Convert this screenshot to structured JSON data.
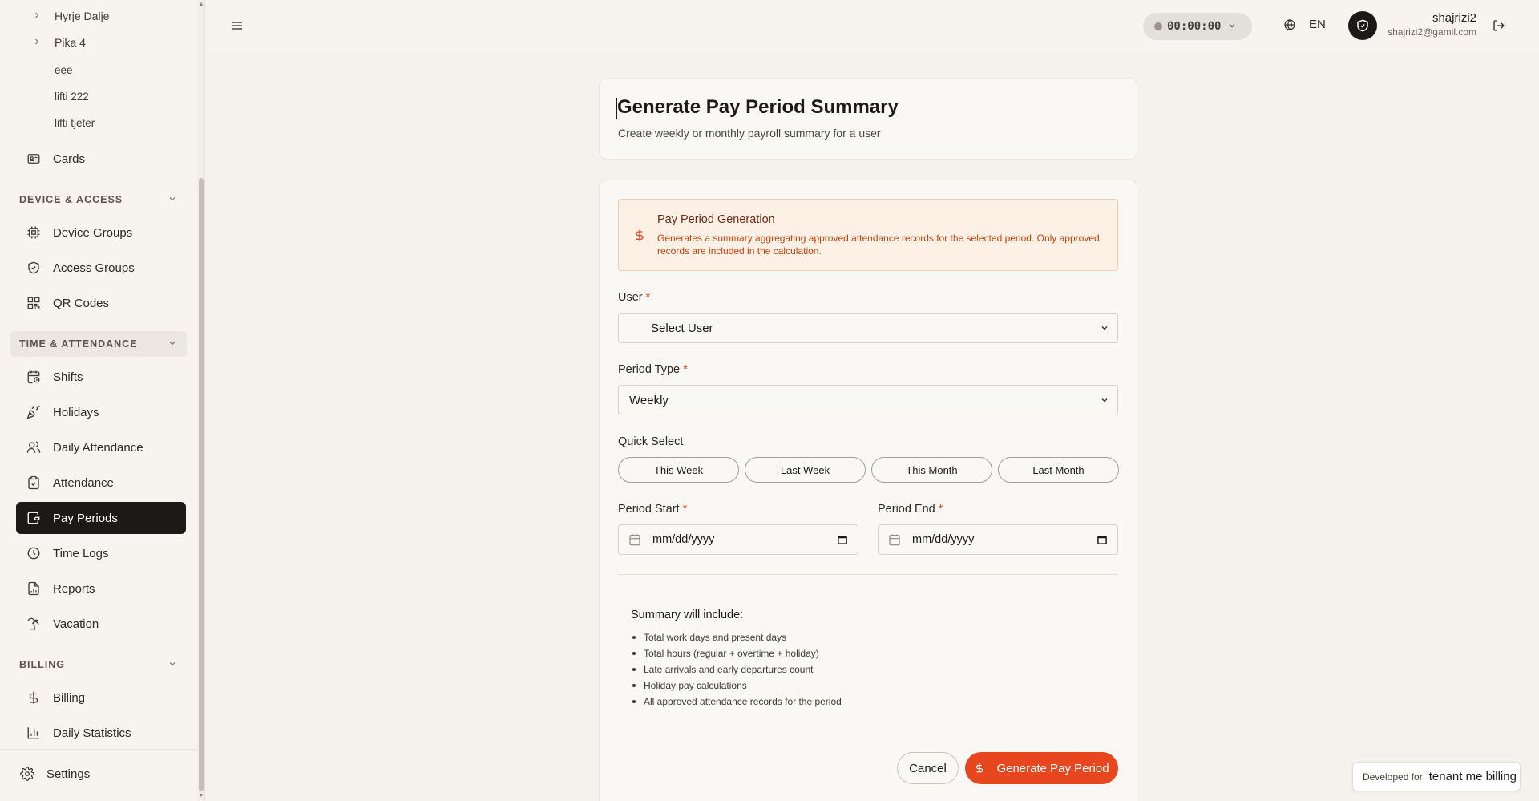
{
  "sidebar": {
    "sub_items": [
      {
        "label": "Hyrje Dalje",
        "has_chevron": true
      },
      {
        "label": "Pika 4",
        "has_chevron": true
      },
      {
        "label": "eee",
        "has_chevron": false
      },
      {
        "label": "lifti 222",
        "has_chevron": false
      },
      {
        "label": "lifti tjeter",
        "has_chevron": false
      }
    ],
    "cards": {
      "label": "Cards",
      "icon": "id-card-icon"
    },
    "sections": [
      {
        "title": "DEVICE & ACCESS",
        "items": [
          {
            "label": "Device Groups",
            "icon": "cpu-icon"
          },
          {
            "label": "Access Groups",
            "icon": "shield-check-icon"
          },
          {
            "label": "QR Codes",
            "icon": "qr-code-icon"
          }
        ]
      },
      {
        "title": "TIME & ATTENDANCE",
        "items": [
          {
            "label": "Shifts",
            "icon": "calendar-clock-icon"
          },
          {
            "label": "Holidays",
            "icon": "party-popper-icon"
          },
          {
            "label": "Daily Attendance",
            "icon": "users-icon"
          },
          {
            "label": "Attendance",
            "icon": "clipboard-check-icon"
          },
          {
            "label": "Pay Periods",
            "icon": "wallet-icon",
            "active": true
          },
          {
            "label": "Time Logs",
            "icon": "clock-icon"
          },
          {
            "label": "Reports",
            "icon": "file-chart-icon"
          },
          {
            "label": "Vacation",
            "icon": "palm-tree-icon"
          }
        ]
      },
      {
        "title": "BILLING",
        "items": [
          {
            "label": "Billing",
            "icon": "dollar-icon"
          },
          {
            "label": "Daily Statistics",
            "icon": "bar-chart-icon"
          }
        ]
      }
    ],
    "footer": {
      "label": "Settings",
      "icon": "gear-icon"
    }
  },
  "header": {
    "timer": "00:00:00",
    "language": "EN",
    "user_name": "shajrizi2",
    "user_email": "shajrizi2@gamil.com"
  },
  "page": {
    "title": "Generate Pay Period Summary",
    "subtitle": "Create weekly or monthly payroll summary for a user"
  },
  "alert": {
    "title": "Pay Period Generation",
    "body": "Generates a summary aggregating approved attendance records for the selected period. Only approved records are included in the calculation."
  },
  "form": {
    "user_label": "User",
    "user_value": "Select User",
    "period_type_label": "Period Type",
    "period_type_value": "Weekly",
    "quick_select_label": "Quick Select",
    "quick_select": [
      "This Week",
      "Last Week",
      "This Month",
      "Last Month"
    ],
    "period_start_label": "Period Start",
    "period_start_value": "mm/dd/yyyy",
    "period_end_label": "Period End",
    "period_end_value": "mm/dd/yyyy",
    "required_mark": "*"
  },
  "summary": {
    "heading": "Summary will include:",
    "items": [
      "Total work days and present days",
      "Total hours (regular + overtime + holiday)",
      "Late arrivals and early departures count",
      "Holiday pay calculations",
      "All approved attendance records for the period"
    ]
  },
  "actions": {
    "cancel": "Cancel",
    "generate": "Generate Pay Period"
  },
  "badge": {
    "prefix": "Developed for",
    "name": "tenant me billing"
  },
  "colors": {
    "accent": "#e8461f",
    "active_nav": "#1c1917",
    "alert_bg": "#fdf1e6",
    "alert_text": "#c2410c"
  }
}
